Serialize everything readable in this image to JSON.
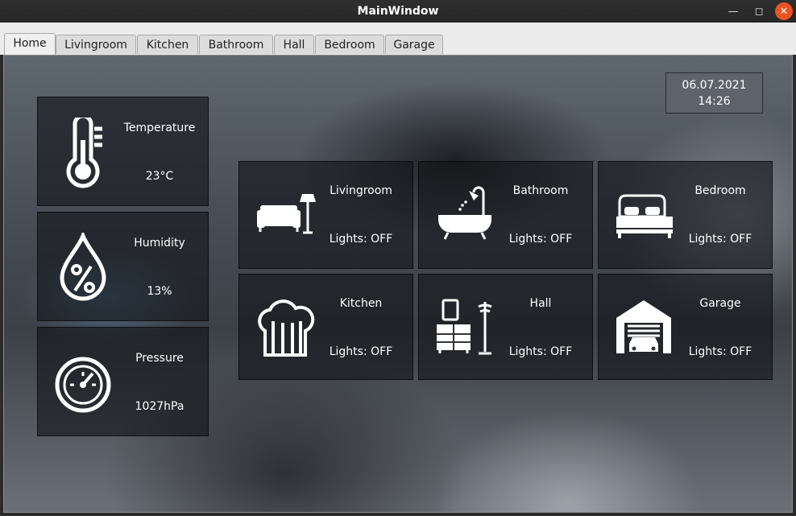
{
  "window": {
    "title": "MainWindow"
  },
  "tabs": [
    "Home",
    "Livingroom",
    "Kitchen",
    "Bathroom",
    "Hall",
    "Bedroom",
    "Garage"
  ],
  "active_tab": "Home",
  "datetime": {
    "date": "06.07.2021",
    "time": "14:26"
  },
  "sensors": {
    "temperature": {
      "label": "Temperature",
      "value": "23°C"
    },
    "humidity": {
      "label": "Humidity",
      "value": "13%"
    },
    "pressure": {
      "label": "Pressure",
      "value": "1027hPa"
    }
  },
  "rooms": {
    "livingroom": {
      "label": "Livingroom",
      "status": "Lights: OFF"
    },
    "bathroom": {
      "label": "Bathroom",
      "status": "Lights: OFF"
    },
    "bedroom": {
      "label": "Bedroom",
      "status": "Lights: OFF"
    },
    "kitchen": {
      "label": "Kitchen",
      "status": "Lights: OFF"
    },
    "hall": {
      "label": "Hall",
      "status": "Lights: OFF"
    },
    "garage": {
      "label": "Garage",
      "status": "Lights: OFF"
    }
  },
  "icons": {
    "temperature": "thermometer-icon",
    "humidity": "water-drop-percent-icon",
    "pressure": "gauge-icon",
    "livingroom": "sofa-lamp-icon",
    "bathroom": "bathtub-shower-icon",
    "bedroom": "bed-icon",
    "kitchen": "chef-hat-cutlery-icon",
    "hall": "dresser-coat-rack-icon",
    "garage": "garage-car-icon"
  },
  "colors": {
    "close_button": "#e95420",
    "panel_text": "#ffffff"
  }
}
